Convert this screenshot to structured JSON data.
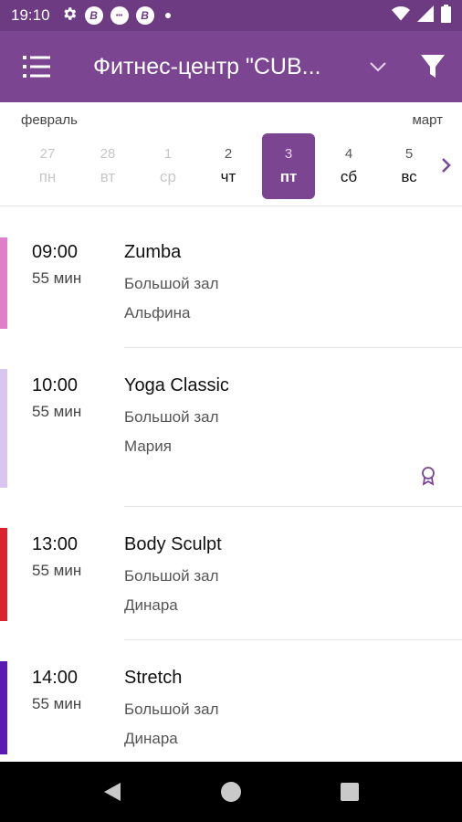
{
  "status_bar": {
    "time": "19:10",
    "icons": [
      "settings-icon",
      "vk-notification-icon",
      "other-notification-icon",
      "vk-notification-icon",
      "dot-icon",
      "wifi-icon",
      "signal-icon",
      "battery-icon"
    ],
    "notif_letters": [
      "В",
      "В"
    ]
  },
  "app_bar": {
    "title": "Фитнес-центр \"CUB...",
    "accent_color": "#7b4592",
    "status_color": "#6d3b82"
  },
  "calendar": {
    "month_left": "февраль",
    "month_right": "март",
    "days": [
      {
        "num": "27",
        "wd": "пн",
        "state": "past"
      },
      {
        "num": "28",
        "wd": "вт",
        "state": "past"
      },
      {
        "num": "1",
        "wd": "ср",
        "state": "past"
      },
      {
        "num": "2",
        "wd": "чт",
        "state": "future"
      },
      {
        "num": "3",
        "wd": "пт",
        "state": "selected"
      },
      {
        "num": "4",
        "wd": "сб",
        "state": "future"
      },
      {
        "num": "5",
        "wd": "вс",
        "state": "future"
      }
    ]
  },
  "classes": [
    {
      "time": "09:00",
      "duration": "55 мин",
      "name": "Zumba",
      "room": "Большой зал",
      "trainer": "Альфина",
      "color": "#e07fc9",
      "badge": false
    },
    {
      "time": "10:00",
      "duration": "55 мин",
      "name": "Yoga Classic",
      "room": "Большой зал",
      "trainer": "Мария",
      "color": "#d9c5ef",
      "badge": true
    },
    {
      "time": "13:00",
      "duration": "55 мин",
      "name": "Body Sculpt",
      "room": "Большой зал",
      "trainer": "Динара",
      "color": "#d9232e",
      "badge": false
    },
    {
      "time": "14:00",
      "duration": "55 мин",
      "name": "Stretch",
      "room": "Большой зал",
      "trainer": "Динара",
      "color": "#5b1bb0",
      "badge": false
    }
  ]
}
